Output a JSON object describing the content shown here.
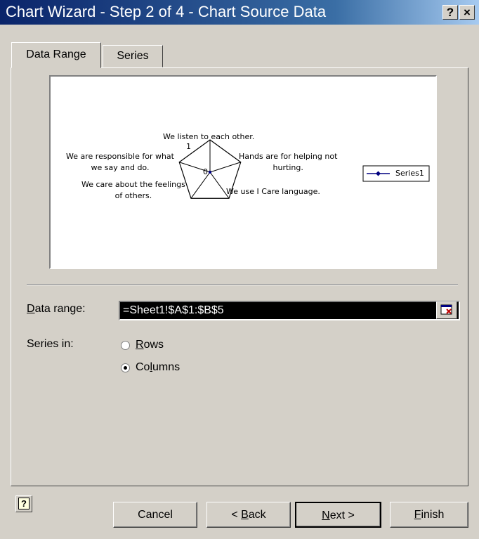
{
  "window": {
    "title": "Chart Wizard - Step 2 of 4 - Chart Source Data",
    "help": "?",
    "close": "×"
  },
  "tabs": [
    {
      "label": "Data Range",
      "active": true
    },
    {
      "label": "Series",
      "active": false
    }
  ],
  "chart_data": {
    "type": "radar",
    "categories": [
      "We listen to each other.",
      "Hands are for helping not hurting.",
      "We use I Care language.",
      "We care about the feelings of others.",
      "We are responsible for what we say and do."
    ],
    "category_lines": [
      [
        "We listen to each other."
      ],
      [
        "Hands are for helping not",
        "hurting."
      ],
      [
        "We use I Care language."
      ],
      [
        "We care about the feelings",
        "of others."
      ],
      [
        "We are responsible for what",
        "we say and do."
      ]
    ],
    "tick_labels": [
      "0",
      "1"
    ],
    "series": [
      {
        "name": "Series1",
        "values": [
          0,
          0,
          0,
          0,
          0
        ],
        "color": "#000080"
      }
    ],
    "legend": "right"
  },
  "data_range": {
    "label": "Data range:",
    "mnemonic": "D",
    "value": "=Sheet1!$A$1:$B$5"
  },
  "series_in": {
    "label": "Series in:",
    "rows": {
      "label": "Rows",
      "mnemonic": "R",
      "checked": false
    },
    "columns": {
      "label": "Columns",
      "mnemonic": "l",
      "checked": true
    }
  },
  "buttons": {
    "help": "?",
    "cancel": "Cancel",
    "back": "< Back",
    "next": "Next >",
    "finish": "Finish"
  }
}
